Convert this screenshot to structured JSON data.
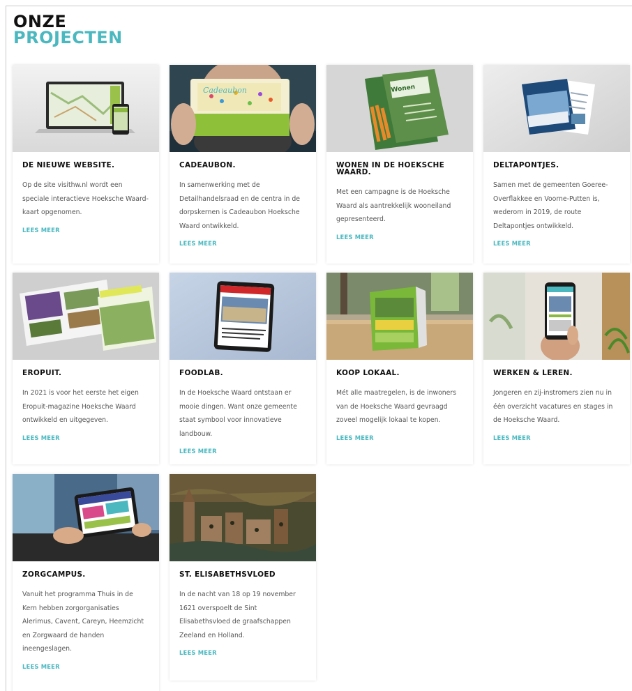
{
  "heading": {
    "line1": "ONZE",
    "line2": "PROJECTEN"
  },
  "accent": "#4bb8c0",
  "cards": [
    {
      "title": "DE NIEUWE WEBSITE.",
      "text": "Op de site visithw.nl wordt een speciale interactieve Hoeksche Waard-kaart opgenomen.",
      "link": "LEES MEER",
      "image": "laptop-phone-map-image"
    },
    {
      "title": "CADEAUBON.",
      "text": "In samenwerking met de Detailhandelsraad en de centra in de dorpskernen is Cadeaubon Hoeksche Waard ontwikkeld.",
      "link": "LEES MEER",
      "image": "gift-card-image",
      "image_text": "Cadeaubon"
    },
    {
      "title": "WONEN IN DE HOEKSCHE WAARD.",
      "text": "Met een campagne is de Hoeksche Waard als aantrekkelijk wooneiland gepresenteerd.",
      "link": "LEES MEER",
      "image": "magazine-image",
      "image_text": "Wonen"
    },
    {
      "title": "DELTAPONTJES.",
      "text": "Samen met de gemeenten Goeree-Overflakkee en Voorne-Putten is, wederom in 2019, de route Deltapontjes ontwikkeld.",
      "link": "LEES MEER",
      "image": "brochure-image"
    },
    {
      "title": "EROPUIT.",
      "text": "In 2021 is voor het eerste het eigen Eropuit-magazine Hoeksche Waard ontwikkeld en uitgegeven.",
      "link": "LEES MEER",
      "image": "eropuit-magazine-image"
    },
    {
      "title": "FOODLAB.",
      "text": "In de Hoeksche Waard ontstaan er mooie dingen. Want onze gemeente staat symbool voor innovatieve landbouw.",
      "link": "LEES MEER",
      "image": "tablet-news-image"
    },
    {
      "title": "KOOP LOKAAL.",
      "text": "Mét alle maatregelen, is de inwoners van de Hoeksche Waard gevraagd zoveel mogelijk lokaal te kopen.",
      "link": "LEES MEER",
      "image": "table-display-image"
    },
    {
      "title": "WERKEN & LEREN.",
      "text": "Jongeren en zij-instromers zien nu in één overzicht vacatures en stages in de Hoeksche Waard.",
      "link": "LEES MEER",
      "image": "hand-phone-image"
    },
    {
      "title": "ZORGCAMPUS.",
      "text": "Vanuit het programma Thuis in de Kern hebben zorgorganisaties Alerimus, Cavent, Careyn, Heemzicht en Zorgwaard de handen ineengeslagen.",
      "link": "LEES MEER",
      "image": "hands-tablet-image"
    },
    {
      "title": "ST. ELISABETHSVLOED",
      "text": "In de nacht van 18 op 19 november 1621 overspoelt de Sint Elisabethsvloed de graafschappen Zeeland en Holland.",
      "link": "LEES MEER",
      "image": "painting-image"
    }
  ]
}
